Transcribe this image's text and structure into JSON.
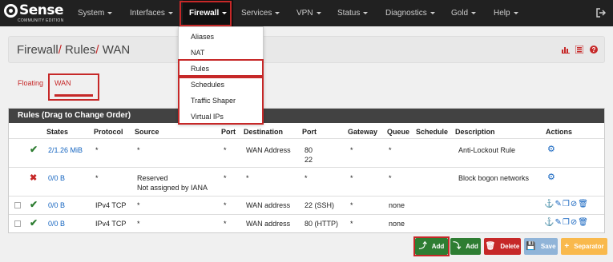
{
  "nav": {
    "logo_text": "Sense",
    "logo_sub": "COMMUNITY EDITION",
    "items": [
      {
        "label": "System"
      },
      {
        "label": "Interfaces"
      },
      {
        "label": "Firewall"
      },
      {
        "label": "Services"
      },
      {
        "label": "VPN"
      },
      {
        "label": "Status"
      },
      {
        "label": "Diagnostics"
      },
      {
        "label": "Gold"
      },
      {
        "label": "Help"
      }
    ]
  },
  "firewall_menu": [
    "Aliases",
    "NAT",
    "Rules",
    "Schedules",
    "Traffic Shaper",
    "Virtual IPs"
  ],
  "breadcrumb": {
    "part1": "Firewall",
    "part2": "Rules",
    "part3": "WAN",
    "sep": "/"
  },
  "tabs": {
    "floating": "Floating",
    "wan": "WAN"
  },
  "panel": {
    "title": "Rules (Drag to Change Order)"
  },
  "columns": [
    "States",
    "Protocol",
    "Source",
    "Port",
    "Destination",
    "Port",
    "Gateway",
    "Queue",
    "Schedule",
    "Description",
    "Actions"
  ],
  "rules": [
    {
      "status": "pass",
      "states": "2/1.26 MiB",
      "protocol": "*",
      "source": "*",
      "source2": "",
      "sport": "*",
      "destination": "WAN Address",
      "dport": "80",
      "dport2": "22",
      "gateway": "*",
      "queue": "*",
      "schedule": "",
      "description": "Anti-Lockout Rule"
    },
    {
      "status": "block",
      "states": "0/0 B",
      "protocol": "*",
      "source": "Reserved",
      "source2": "Not assigned by IANA",
      "sport": "*",
      "destination": "*",
      "dport": "*",
      "dport2": "",
      "gateway": "*",
      "queue": "*",
      "schedule": "",
      "description": "Block bogon networks"
    },
    {
      "status": "pass",
      "states": "0/0 B",
      "protocol": "IPv4 TCP",
      "source": "*",
      "source2": "",
      "sport": "*",
      "destination": "WAN address",
      "dport": "22 (SSH)",
      "dport2": "",
      "gateway": "*",
      "queue": "none",
      "schedule": "",
      "description": ""
    },
    {
      "status": "pass",
      "states": "0/0 B",
      "protocol": "IPv4 TCP",
      "source": "*",
      "source2": "",
      "sport": "*",
      "destination": "WAN address",
      "dport": "80 (HTTP)",
      "dport2": "",
      "gateway": "*",
      "queue": "none",
      "schedule": "",
      "description": ""
    }
  ],
  "buttons": {
    "add_top": "Add",
    "add_bottom": "Add",
    "delete": "Delete",
    "save": "Save",
    "separator": "Separator"
  },
  "colors": {
    "brand_red": "#c62828",
    "navbar": "#212121",
    "link": "#1565c0",
    "pass": "#2e7d32"
  }
}
